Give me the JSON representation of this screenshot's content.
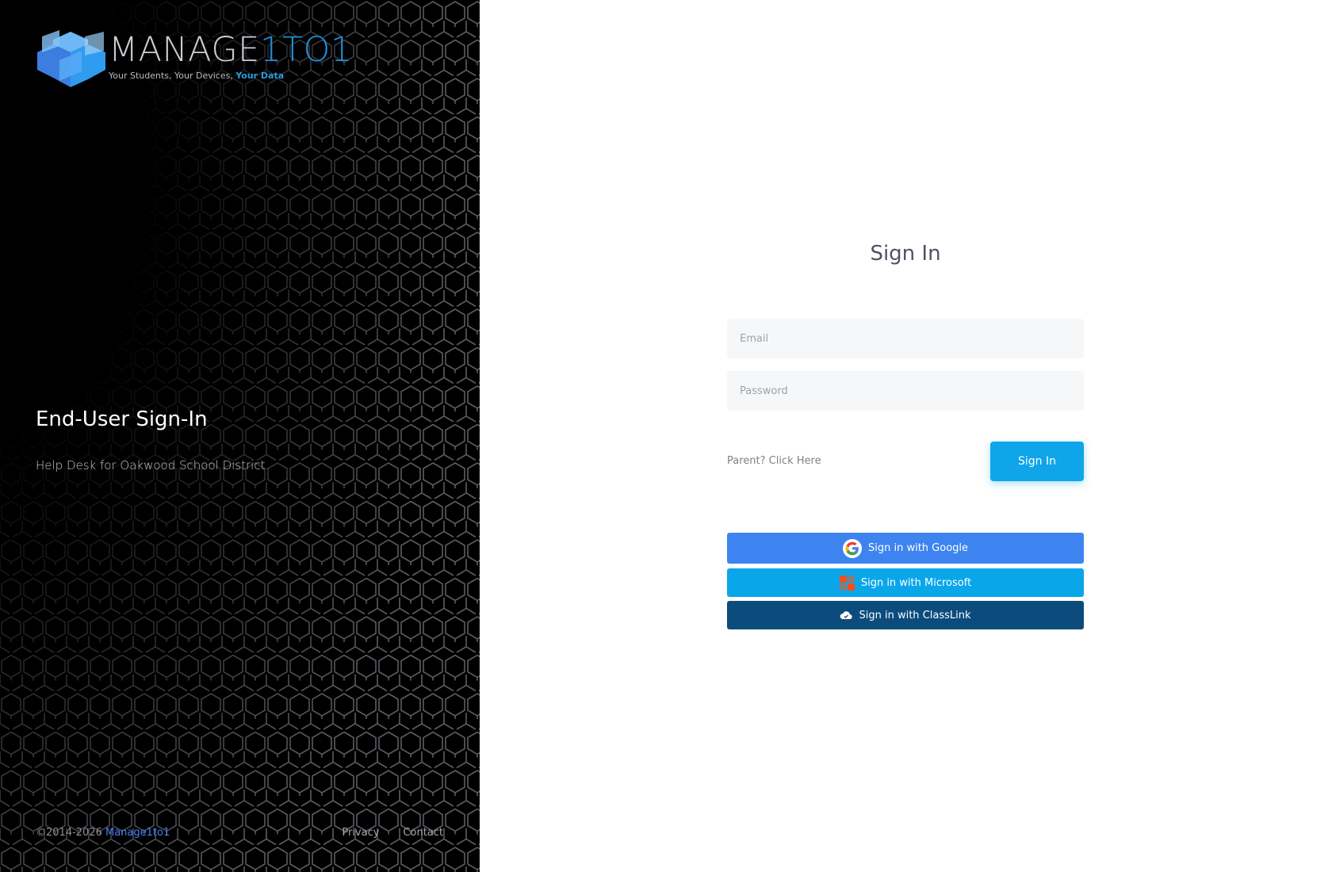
{
  "brand": {
    "logo_word_primary": "MANAGE",
    "logo_word_accent": "1TO1",
    "tagline_prefix": "Your Students, Your Devices, ",
    "tagline_highlight": "Your Data",
    "accent_color": "#1e8fd8"
  },
  "left_panel": {
    "title": "End-User Sign-In",
    "subtitle": "Help Desk for Oakwood School District."
  },
  "footer": {
    "copyright": "©2014-2026 ",
    "company_link": "Manage1to1",
    "links": [
      "Privacy",
      "Contact"
    ]
  },
  "form": {
    "title": "Sign In",
    "email_placeholder": "Email",
    "password_placeholder": "Password",
    "parent_link": "Parent? Click Here",
    "submit_label": "Sign In"
  },
  "sso": {
    "google": {
      "label": "Sign in with Google",
      "color": "#3d84f0",
      "icon": "google-icon"
    },
    "microsoft": {
      "label": "Sign in with Microsoft",
      "color": "#0aa6ea",
      "icon": "microsoft-icon"
    },
    "classlink": {
      "label": "Sign in with ClassLink",
      "color": "#0b4c7d",
      "icon": "classlink-cloud-icon"
    }
  }
}
